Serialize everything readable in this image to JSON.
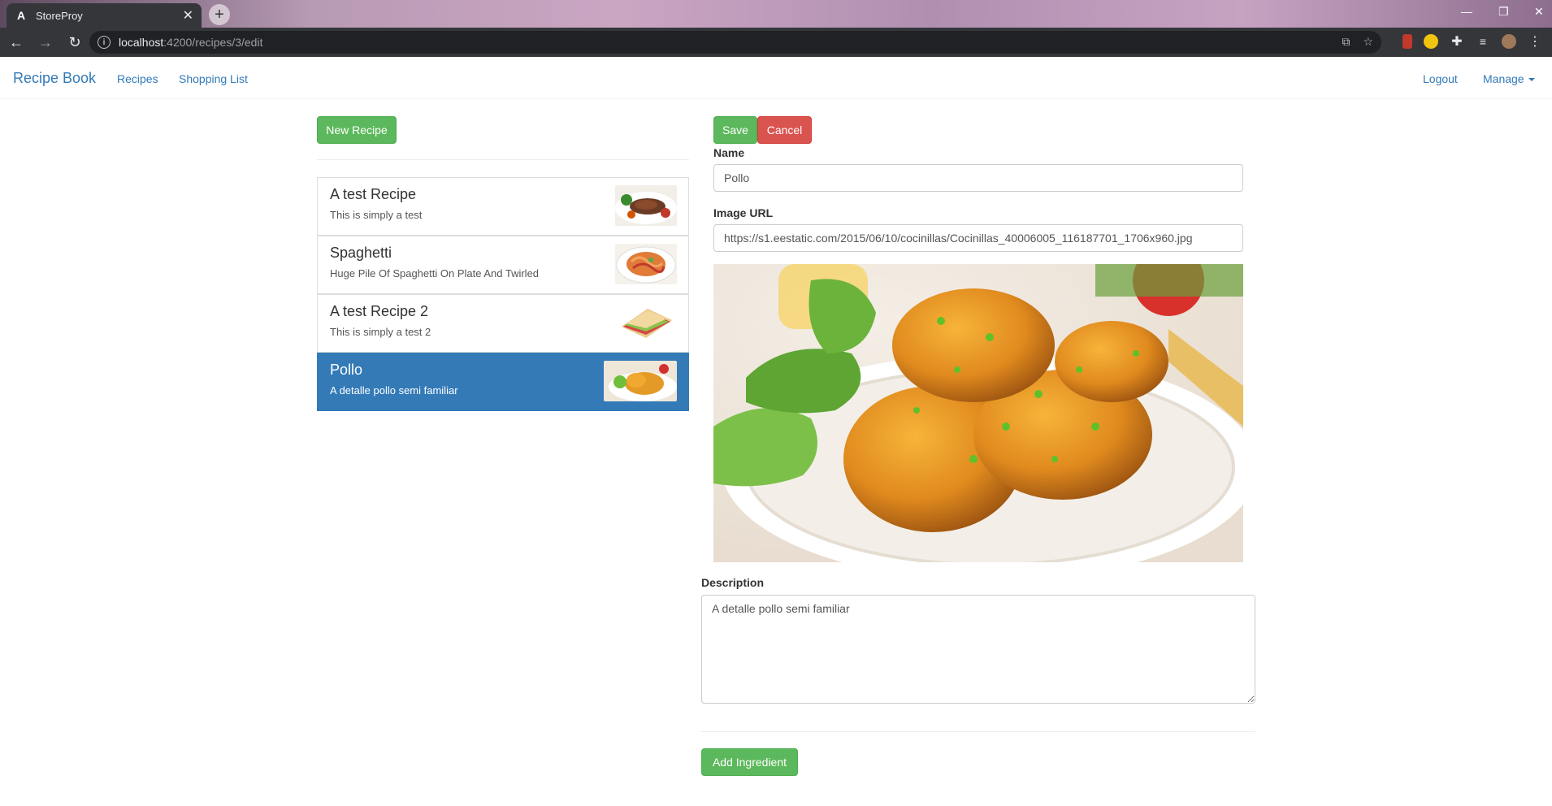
{
  "browser": {
    "tab_title": "StoreProy",
    "tab_favicon": "A",
    "url_host": "localhost",
    "url_path": ":4200/recipes/3/edit"
  },
  "nav": {
    "brand": "Recipe Book",
    "links": [
      "Recipes",
      "Shopping List"
    ],
    "logout": "Logout",
    "manage": "Manage"
  },
  "list": {
    "new_button": "New Recipe",
    "recipes": [
      {
        "name": "A test Recipe",
        "description": "This is simply a test",
        "image": "steak-plate"
      },
      {
        "name": "Spaghetti",
        "description": "Huge Pile Of Spaghetti On Plate And Twirled",
        "image": "spaghetti-plate"
      },
      {
        "name": "A test Recipe 2",
        "description": "This is simply a test 2",
        "image": "sandwich"
      },
      {
        "name": "Pollo",
        "description": "A detalle pollo semi familiar",
        "image": "chicken-plate",
        "active": true
      }
    ]
  },
  "form": {
    "save": "Save",
    "cancel": "Cancel",
    "name_label": "Name",
    "name_value": "Pollo",
    "image_label": "Image URL",
    "image_value": "https://s1.eestatic.com/2015/06/10/cocinillas/Cocinillas_40006005_116187701_1706x960.jpg",
    "description_label": "Description",
    "description_value": "A detalle pollo semi familiar",
    "add_ingredient": "Add Ingredient"
  },
  "colors": {
    "primary": "#337ab7",
    "success": "#5cb85c",
    "danger": "#d9534f"
  }
}
